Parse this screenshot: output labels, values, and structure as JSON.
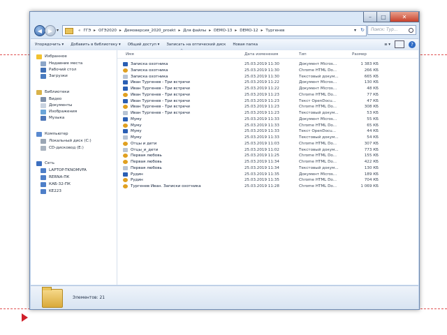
{
  "window": {
    "controls": {
      "minimize": "–",
      "maximize": "□",
      "close": "✕"
    }
  },
  "address": {
    "crumbs": [
      "ГГЭ",
      "ОГЭ2020",
      "Демоверсия_2020_proekt",
      "Для файлы",
      "DEMO-13",
      "DEMO-12",
      "Тургенев"
    ],
    "search_placeholder": "Поиск: Тур..."
  },
  "toolbar": {
    "organize": "Упорядочить ▾",
    "add_library": "Добавить в библиотеку ▾",
    "share": "Общий доступ ▾",
    "burn": "Записать на оптический диск",
    "new_folder": "Новая папка",
    "views": "≡ ▾",
    "help": "?"
  },
  "nav": {
    "favorites": "Избранное",
    "recent": "Недавние места",
    "desktop": "Рабочий стол",
    "downloads": "Загрузки",
    "libraries": "Библиотеки",
    "video": "Видео",
    "documents": "Документы",
    "images": "Изображения",
    "music": "Музыка",
    "computer": "Компьютер",
    "local_disk": "Локальный диск (C:)",
    "cd_drive": "CD-дисковод (E:)",
    "network": "Сеть",
    "net1": "LAPTOP-TKNOMVFA",
    "net2": "RERNA-ПК",
    "net3": "КАБ-32-ПК",
    "net4": "KE223"
  },
  "columns": {
    "name": "Имя",
    "date": "Дата изменения",
    "type": "Тип",
    "size": "Размер"
  },
  "files": [
    {
      "name": "Записка охотника",
      "date": "25.03.2019 11:30",
      "type": "Документ Micros...",
      "size": "1 383 КБ",
      "icon": "word-icon",
      "color": "#2b5fb4"
    },
    {
      "name": "Записка охотника",
      "date": "25.03.2019 11:30",
      "type": "Chrome HTML Do...",
      "size": "266 КБ",
      "icon": "chrome-icon",
      "color": "#e0a020"
    },
    {
      "name": "Записка охотника",
      "date": "25.03.2019 11:30",
      "type": "Текстовый докум...",
      "size": "665 КБ",
      "icon": "text-icon",
      "color": "#b8c4d4"
    },
    {
      "name": "Иван Тургенев - Три встречи",
      "date": "25.03.2019 11:22",
      "type": "Документ Micros...",
      "size": "130 КБ",
      "icon": "word-icon",
      "color": "#2b5fb4"
    },
    {
      "name": "Иван Тургенев - Три встречи",
      "date": "25.03.2019 11:22",
      "type": "Документ Micros...",
      "size": "48 КБ",
      "icon": "word-icon",
      "color": "#2b5fb4"
    },
    {
      "name": "Иван Тургенев - Три встречи",
      "date": "25.03.2019 11:23",
      "type": "Chrome HTML Do...",
      "size": "77 КБ",
      "icon": "chrome-icon",
      "color": "#e0a020"
    },
    {
      "name": "Иван Тургенев - Три встречи",
      "date": "25.03.2019 11:23",
      "type": "Текст OpenDocu...",
      "size": "47 КБ",
      "icon": "odt-icon",
      "color": "#2b5fb4"
    },
    {
      "name": "Иван Тургенев - Три встречи",
      "date": "25.03.2019 11:23",
      "type": "Chrome HTML Do...",
      "size": "308 КБ",
      "icon": "chrome-icon",
      "color": "#e0a020"
    },
    {
      "name": "Иван Тургенев - Три встречи",
      "date": "25.03.2019 11:23",
      "type": "Текстовый докум...",
      "size": "53 КБ",
      "icon": "text-icon",
      "color": "#b8c4d4"
    },
    {
      "name": "Муму",
      "date": "25.03.2019 11:33",
      "type": "Документ Micros...",
      "size": "55 КБ",
      "icon": "word-icon",
      "color": "#2b5fb4"
    },
    {
      "name": "Муму",
      "date": "25.03.2019 11:33",
      "type": "Chrome HTML Do...",
      "size": "65 КБ",
      "icon": "chrome-icon",
      "color": "#e0a020"
    },
    {
      "name": "Муму",
      "date": "25.03.2019 11:33",
      "type": "Текст OpenDocu...",
      "size": "44 КБ",
      "icon": "odt-icon",
      "color": "#2b5fb4"
    },
    {
      "name": "Муму",
      "date": "25.03.2019 11:33",
      "type": "Текстовый докум...",
      "size": "54 КБ",
      "icon": "text-icon",
      "color": "#b8c4d4"
    },
    {
      "name": "Отцы и дети",
      "date": "25.03.2019 11:03",
      "type": "Chrome HTML Do...",
      "size": "307 КБ",
      "icon": "chrome-icon",
      "color": "#e0a020"
    },
    {
      "name": "Отцы_и_дети",
      "date": "25.03.2019 11:02",
      "type": "Текстовый докум...",
      "size": "773 КБ",
      "icon": "text-icon",
      "color": "#b8c4d4"
    },
    {
      "name": "Первая любовь",
      "date": "25.03.2019 11:25",
      "type": "Chrome HTML Do...",
      "size": "155 КБ",
      "icon": "chrome-icon",
      "color": "#e0a020"
    },
    {
      "name": "Первая любовь",
      "date": "25.03.2019 11:34",
      "type": "Chrome HTML Do...",
      "size": "422 КБ",
      "icon": "chrome-icon",
      "color": "#e0a020"
    },
    {
      "name": "Первая любовь",
      "date": "25.03.2019 11:34",
      "type": "Текстовый докум...",
      "size": "130 КБ",
      "icon": "text-icon",
      "color": "#b8c4d4"
    },
    {
      "name": "Рудин",
      "date": "25.03.2019 11:35",
      "type": "Документ Micros...",
      "size": "189 КБ",
      "icon": "word-icon",
      "color": "#2b5fb4"
    },
    {
      "name": "Рудин",
      "date": "25.03.2019 11:35",
      "type": "Chrome HTML Do...",
      "size": "704 КБ",
      "icon": "chrome-icon",
      "color": "#e0a020"
    },
    {
      "name": "Тургенев Иван. Записки охотника",
      "date": "25.03.2019 11:28",
      "type": "Chrome HTML Do...",
      "size": "1 069 КБ",
      "icon": "chrome-icon",
      "color": "#e0a020"
    }
  ],
  "status": {
    "count": "Элементов: 21"
  },
  "colors": {
    "accent": "#2d5fa8",
    "folder": "#e9c35a",
    "marker": "#d0202a"
  }
}
